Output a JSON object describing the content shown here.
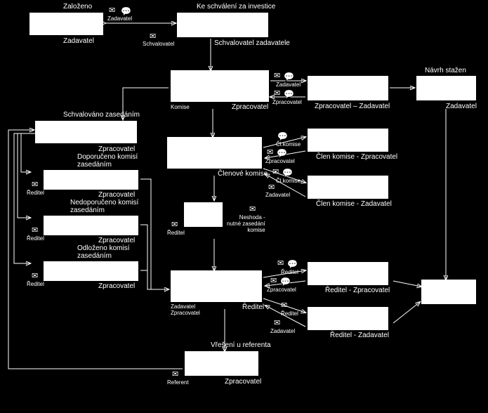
{
  "nodes": {
    "zalozeno": {
      "title": "Založeno",
      "role": "Zadavatel"
    },
    "keSchvaleni": {
      "title": "Ke schválení za investice",
      "role": "Schvalovatel zadavatele",
      "iconNote": "Schvalovatel"
    },
    "zpracovatel": {
      "title": "",
      "role": "Zpracovatel",
      "iconNote": "Komise"
    },
    "clenoveKomise": {
      "title": "",
      "role": "Členové komise"
    },
    "neshoda": {
      "title": "",
      "role": "",
      "note": "Neshoda -\nnutné zasedání\nkomise",
      "iconLeft": "Ředitel"
    },
    "reditel": {
      "title": "",
      "role": "Ředitel",
      "left": "Zadavatel\nZpracovatel"
    },
    "referent": {
      "title": "Vřešení u referenta",
      "role": "Zpracovatel",
      "iconLeft": "Referent"
    },
    "schvalovano": {
      "title": "Schvalováno zasedáním",
      "role": "Zpracovatel"
    },
    "doporuceno": {
      "title": "Doporučeno komisí\nzasedáním",
      "role": "Zpracovatel",
      "iconLeft": "Ředitel"
    },
    "nedoporuceno": {
      "title": "Nedoporučeno komisí\nzasedáním",
      "role": "Zpracovatel",
      "iconLeft": "Ředitel"
    },
    "odlozeno": {
      "title": "Odloženo komisí\nzasedáním",
      "role": "Zpracovatel",
      "iconLeft": "Ředitel"
    },
    "zpracZadav": {
      "title": "",
      "role": "Zpracovatel – Zadavatel"
    },
    "navrhStazen": {
      "title": "Návrh stažen",
      "role": "Zadavatel"
    },
    "clKomZprac": {
      "title": "",
      "role": "Člen komise - Zpracovatel"
    },
    "clKomZadav": {
      "title": "",
      "role": "Člen komise - Zadavatel"
    },
    "reditelZprac": {
      "title": "",
      "role": "Ředitel - Zpracovatel"
    },
    "reditelZadav": {
      "title": "",
      "role": "Ředitel - Zadavatel"
    },
    "bottomRight": {
      "title": "",
      "role": ""
    }
  },
  "edgeIcons": {
    "zadavatel": "Zadavatel",
    "zpracovatel": "Zpracovatel",
    "clKomise": "Čl.komise",
    "reditel": "Ředitel"
  }
}
